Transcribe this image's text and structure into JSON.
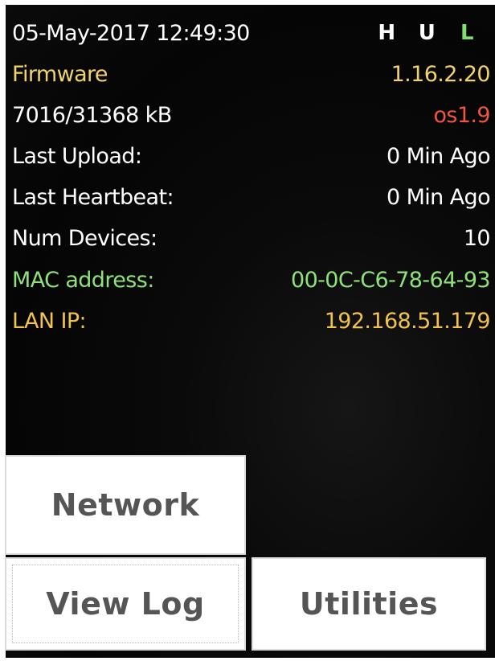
{
  "status": {
    "datetime": "05-May-2017 12:49:30",
    "indicators": [
      {
        "label": "H",
        "color": "#ffffff"
      },
      {
        "label": "U",
        "color": "#ffffff"
      },
      {
        "label": "L",
        "color": "#7ee06a"
      }
    ]
  },
  "info": {
    "firmware": {
      "label": "Firmware",
      "value": "1.16.2.20",
      "label_color": "#f2d36b",
      "value_color": "#f2d36b"
    },
    "memory": {
      "label": "7016/31368 kB",
      "value": "os1.9",
      "label_color": "#ffffff",
      "value_color": "#f0553e"
    },
    "last_upload": {
      "label": "Last Upload:",
      "value": "0 Min Ago",
      "label_color": "#ffffff",
      "value_color": "#ffffff"
    },
    "last_heartbeat": {
      "label": "Last Heartbeat:",
      "value": "0 Min Ago",
      "label_color": "#ffffff",
      "value_color": "#ffffff"
    },
    "num_devices": {
      "label": "Num Devices:",
      "value": "10",
      "label_color": "#ffffff",
      "value_color": "#ffffff"
    },
    "mac_address": {
      "label": "MAC address:",
      "value": "00-0C-C6-78-64-93",
      "label_color": "#8fe27a",
      "value_color": "#8fe27a"
    },
    "lan_ip": {
      "label": "LAN IP:",
      "value": "192.168.51.179",
      "label_color": "#f2c24e",
      "value_color": "#f2c24e"
    }
  },
  "buttons": {
    "network": "Network",
    "view_log": "View Log",
    "utilities": "Utilities"
  }
}
